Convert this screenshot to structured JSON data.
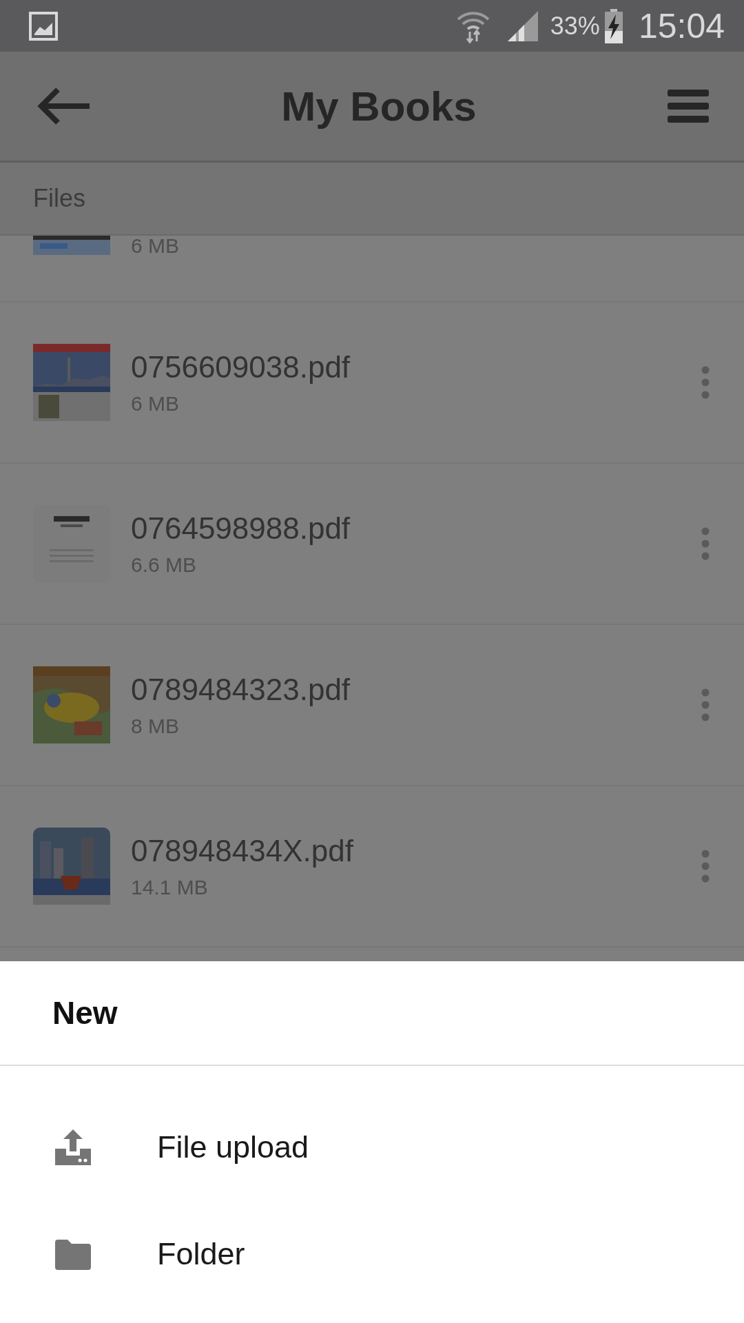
{
  "status_bar": {
    "battery": "33%",
    "time": "15:04"
  },
  "app_bar": {
    "title": "My Books"
  },
  "section": {
    "title": "Files"
  },
  "files": [
    {
      "kind": "partial",
      "size": "6 MB"
    },
    {
      "kind": "full",
      "name": "0756609038.pdf",
      "size": "6 MB"
    },
    {
      "kind": "full",
      "name": "0764598988.pdf",
      "size": "6.6 MB"
    },
    {
      "kind": "full",
      "name": "0789484323.pdf",
      "size": "8 MB"
    },
    {
      "kind": "full",
      "name": "078948434X.pdf",
      "size": "14.1 MB"
    }
  ],
  "sheet": {
    "title": "New",
    "items": [
      {
        "kind": "upload",
        "label": "File upload"
      },
      {
        "kind": "folder",
        "label": "Folder"
      }
    ]
  }
}
